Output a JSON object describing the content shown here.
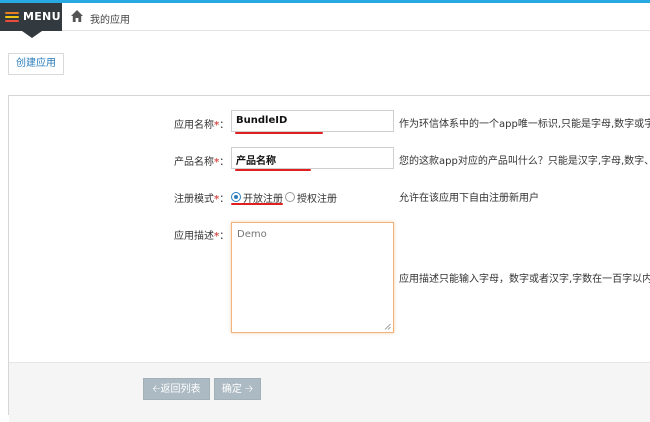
{
  "header": {
    "menu_label": "MENU",
    "breadcrumb": "我的应用"
  },
  "toolbar": {
    "create_label": "创建应用"
  },
  "form": {
    "app_name": {
      "label": "应用名称",
      "required_mark": "*",
      "colon": "：",
      "value": "BundleID",
      "hint": "作为环信体系中的一个app唯一标识,只能是字母,数字或字母"
    },
    "product_name": {
      "label": "产品名称",
      "required_mark": "*",
      "colon": "：",
      "value": "产品名称",
      "hint": "您的这款app对应的产品叫什么？只能是汉字,字母,数字、横"
    },
    "register_mode": {
      "label": "注册模式",
      "required_mark": "*",
      "colon": "：",
      "options": [
        "开放注册",
        "授权注册"
      ],
      "selected": "开放注册",
      "hint": "允许在该应用下自由注册新用户"
    },
    "description": {
      "label": "应用描述",
      "required_mark": "*",
      "colon": "：",
      "value": "Demo",
      "hint": "应用描述只能输入字母，数字或者汉字,字数在一百字以内!"
    }
  },
  "footer": {
    "back_label": "返回列表",
    "confirm_label": "确定"
  },
  "colors": {
    "accent": "#27a9e3",
    "menu_bg": "#333a3f",
    "link": "#2b7dbc",
    "required": "#d9534f",
    "focus_border": "#f0b37e",
    "button_gray": "#abbac3"
  }
}
